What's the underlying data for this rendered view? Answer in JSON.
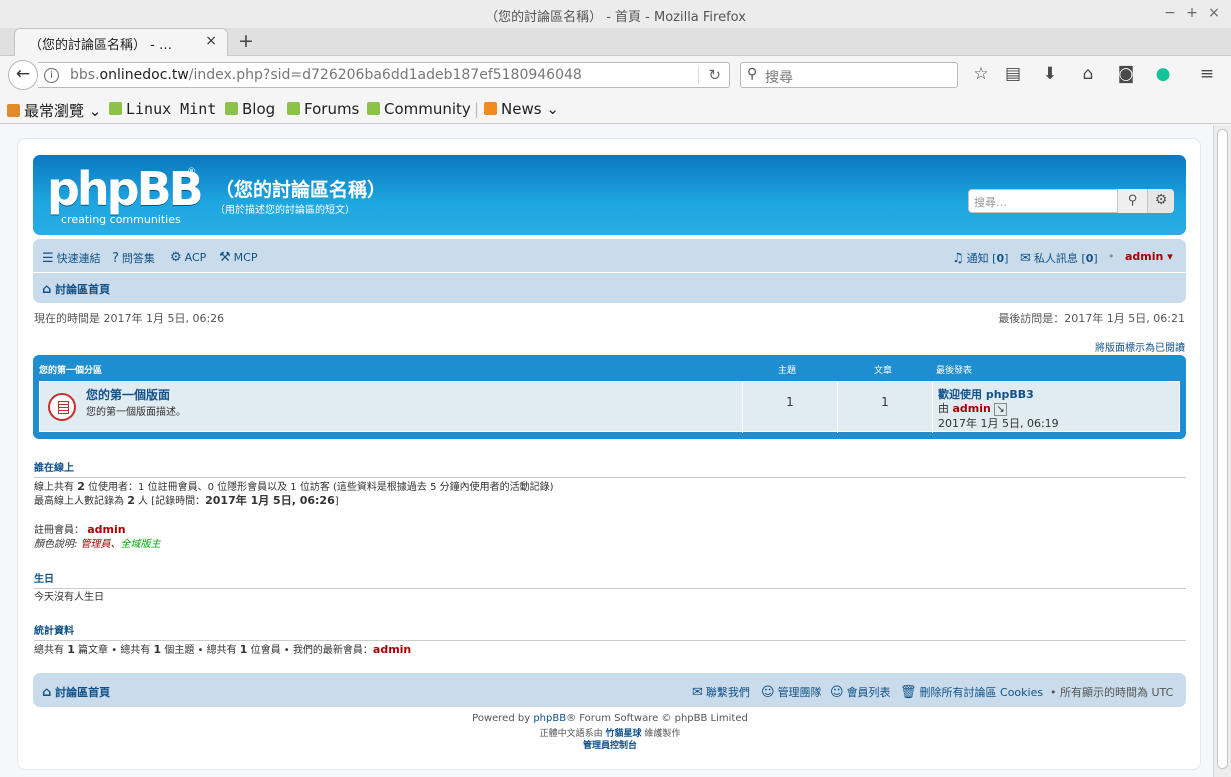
{
  "window": {
    "title": "（您的討論區名稱） - 首頁 - Mozilla Firefox"
  },
  "tab": {
    "label": "（您的討論區名稱） - …",
    "close": "×",
    "new": "+"
  },
  "url": {
    "host_prefix": "bbs.",
    "host": "onlinedoc.tw",
    "path": "/index.php?sid=d726206ba6dd1adeb187ef5180946048"
  },
  "search": {
    "placeholder": "搜尋"
  },
  "bookmarks": {
    "most_visited": "最常瀏覽",
    "items": [
      "Linux Mint",
      "Blog",
      "Forums",
      "Community"
    ],
    "news": "News"
  },
  "forum": {
    "logo_text": "phpBB",
    "logo_sub": "creating communities",
    "site_name": "（您的討論區名稱）",
    "site_desc": "（用於描述您的討論區的短文）",
    "search_placeholder": "搜尋…",
    "nav": {
      "quick_links": "快速連結",
      "faq": "問答集",
      "acp": "ACP",
      "mcp": "MCP",
      "notifications": "通知",
      "notifications_count": "0",
      "pm": "私人訊息",
      "pm_count": "0",
      "user": "admin",
      "home": "討論區首頁"
    },
    "time_now": "現在的時間是 2017年 1月 5日, 06:26",
    "last_visit": "最後訪問是：2017年 1月 5日, 06:21",
    "mark_read": "將版面標示為已閱讀",
    "category": {
      "name": "您的第一個分區",
      "col_topics": "主題",
      "col_posts": "文章",
      "col_last": "最後發表"
    },
    "forums": [
      {
        "name": "您的第一個版面",
        "desc": "您的第一個版面描述。",
        "topics": "1",
        "posts": "1",
        "last_title": "歡迎使用 phpBB3",
        "last_by": "由",
        "last_user": "admin",
        "last_time": "2017年 1月 5日, 06:19"
      }
    ],
    "online": {
      "title": "誰在線上",
      "line1_a": "線上共有",
      "line1_n": "2",
      "line1_b": "位使用者：1 位註冊會員、0 位隱形會員以及 1 位訪客 (這些資料是根據過去 5 分鐘內使用者的活動記錄)",
      "line2_a": "最高線上人數記錄為",
      "line2_n": "2",
      "line2_b": "人 [記錄時間：",
      "line2_t": "2017年 1月 5日, 06:26",
      "line2_c": "]",
      "reg_label": "註冊會員：",
      "reg_user": "admin",
      "legend_label": "顏色說明:",
      "legend_admin": "管理員",
      "legend_sep": "、",
      "legend_mod": "全域版主"
    },
    "birthdays": {
      "title": "生日",
      "text": "今天沒有人生日"
    },
    "stats": {
      "title": "統計資料",
      "a": "總共有",
      "posts_n": "1",
      "b": "篇文章 • 總共有",
      "topics_n": "1",
      "c": "個主題 • 總共有",
      "users_n": "1",
      "d": "位會員 • 我們的最新會員：",
      "newest": "admin"
    },
    "footer": {
      "home": "討論區首頁",
      "contact": "聯繫我們",
      "team": "管理團隊",
      "members": "會員列表",
      "delete_cookies": "刪除所有討論區 Cookies",
      "timezone": "所有顯示的時間為 UTC",
      "powered_a": "Powered by",
      "powered_link": "phpBB",
      "powered_b": "® Forum Software © phpBB Limited",
      "translation_a": "正體中文語系由",
      "translation_b": "竹貓星球",
      "translation_c": "維護製作",
      "acp": "管理員控制台"
    }
  },
  "colors": {
    "header_blue": "#1da6e0",
    "nav_bg": "#cadceb",
    "link": "#105289",
    "admin_red": "#aa0000"
  }
}
